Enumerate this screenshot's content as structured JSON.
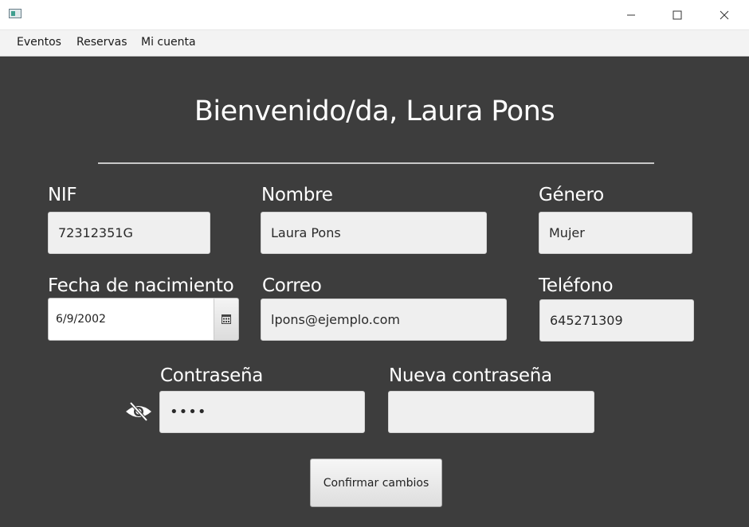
{
  "window": {
    "app_icon": "app-window-icon",
    "controls": [
      "minimize-icon",
      "maximize-icon",
      "close-icon"
    ]
  },
  "menu": {
    "items": [
      "Eventos",
      "Reservas",
      "Mi cuenta"
    ]
  },
  "header": {
    "welcome": "Bienvenido/da, Laura Pons"
  },
  "form": {
    "nif": {
      "label": "NIF",
      "value": "72312351G"
    },
    "nombre": {
      "label": "Nombre",
      "value": "Laura Pons"
    },
    "genero": {
      "label": "Género",
      "value": "Mujer"
    },
    "fecha": {
      "label": "Fecha de nacimiento",
      "value": "6/9/2002",
      "icon": "calendar-icon"
    },
    "correo": {
      "label": "Correo",
      "value": "lpons@ejemplo.com"
    },
    "telefono": {
      "label": "Teléfono",
      "value": "645271309"
    },
    "contrasena": {
      "label": "Contraseña",
      "value": "••••",
      "toggle_icon": "eye-slash-icon"
    },
    "nueva_contrasena": {
      "label": "Nueva contraseña",
      "value": ""
    }
  },
  "actions": {
    "confirm_label": "Confirmar cambios"
  },
  "colors": {
    "background": "#3d3d3d",
    "field": "#efefef",
    "text_light": "#ffffff"
  }
}
